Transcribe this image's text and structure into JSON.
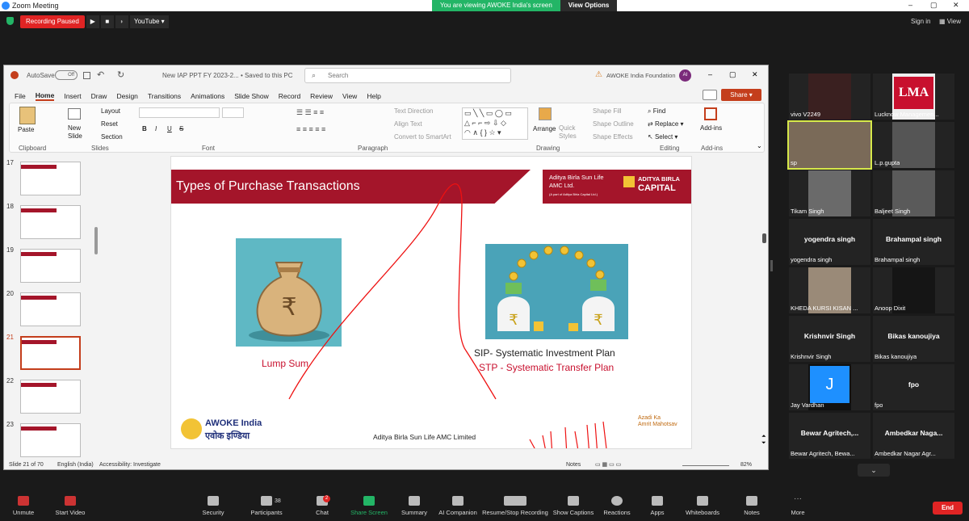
{
  "window": {
    "title": "Zoom Meeting"
  },
  "banner": {
    "text": "You are viewing AWOKE India's screen",
    "view_options": "View Options"
  },
  "topbar": {
    "recording": "Recording Paused",
    "youtube": "YouTube",
    "sign_in": "Sign in",
    "view": "View"
  },
  "ppt": {
    "autosave": "AutoSave",
    "autosave_state": "Off",
    "doc_title": "New IAP PPT FY 2023-2... • Saved to this PC",
    "search_placeholder": "Search",
    "org": "AWOKE India Foundation",
    "avatar": "AI",
    "share": "Share",
    "tabs": [
      "File",
      "Home",
      "Insert",
      "Draw",
      "Design",
      "Transitions",
      "Animations",
      "Slide Show",
      "Record",
      "Review",
      "View",
      "Help"
    ],
    "ribbon": {
      "paste": "Paste",
      "clipboard": "Clipboard",
      "new_slide": "New Slide",
      "layout": "Layout",
      "reset": "Reset",
      "section": "Section",
      "slides": "Slides",
      "font": "Font",
      "paragraph": "Paragraph",
      "text_direction": "Text Direction",
      "align_text": "Align Text",
      "smartart": "Convert to SmartArt",
      "arrange": "Arrange",
      "quick_styles": "Quick Styles",
      "shape_fill": "Shape Fill",
      "shape_outline": "Shape Outline",
      "shape_effects": "Shape Effects",
      "drawing": "Drawing",
      "find": "Find",
      "replace": "Replace",
      "select": "Select",
      "editing": "Editing",
      "addins": "Add-ins",
      "addins_group": "Add-ins"
    },
    "thumbs": [
      "17",
      "18",
      "19",
      "20",
      "21",
      "22",
      "23"
    ],
    "status": {
      "slide": "Slide 21 of 70",
      "lang": "English (India)",
      "accessibility": "Accessibility: Investigate",
      "notes": "Notes",
      "zoom": "82%"
    }
  },
  "slide": {
    "title": "Types of Purchase Transactions",
    "brand_line1": "Aditya Birla Sun Life",
    "brand_line2": "AMC Ltd.",
    "brand_sub": "(A part of Aditya Birla Capital Ltd.)",
    "logo_top": "ADITYA BIRLA",
    "logo_bottom": "CAPITAL",
    "lump_sum": "Lump Sum",
    "sip": "SIP- Systematic Investment Plan",
    "stp": "STP - Systematic Transfer Plan",
    "awoke": "AWOKE India",
    "awoke_hindi": "एवोक इण्डिया",
    "footer": "Aditya Birla Sun Life AMC Limited",
    "azadi1": "Azadi",
    "azadi2": "Ka",
    "azadi3": "Amrit Mahotsav"
  },
  "participants": [
    {
      "name": "vivo V2249",
      "big": ""
    },
    {
      "name": "Lucknow Managemen...",
      "big": ""
    },
    {
      "name": "sp",
      "big": ""
    },
    {
      "name": "L.p.gupta",
      "big": ""
    },
    {
      "name": "Tikam Singh",
      "big": ""
    },
    {
      "name": "Baljeet Singh",
      "big": ""
    },
    {
      "name": "yogendra singh",
      "big": "yogendra singh"
    },
    {
      "name": "Brahampal singh",
      "big": "Brahampal singh"
    },
    {
      "name": "KHEDA KURSI KISAN ...",
      "big": ""
    },
    {
      "name": "Anoop Dixit",
      "big": ""
    },
    {
      "name": "Krishnvir Singh",
      "big": "Krishnvir Singh"
    },
    {
      "name": "Bikas kanoujiya",
      "big": "Bikas kanoujiya"
    },
    {
      "name": "Jay Vardhan",
      "big": ""
    },
    {
      "name": "fpo",
      "big": "fpo"
    },
    {
      "name": "Bewar Agritech, Bewa...",
      "big": "Bewar Agritech,..."
    },
    {
      "name": "Ambedkar Nagar Agr...",
      "big": "Ambedkar Naga..."
    }
  ],
  "avatar_letter": "J",
  "lma": "LMA",
  "toolbar": {
    "unmute": "Unmute",
    "video": "Start Video",
    "security": "Security",
    "participants": "Participants",
    "participants_count": "38",
    "chat": "Chat",
    "chat_badge": "2",
    "share": "Share Screen",
    "summary": "Summary",
    "ai": "AI Companion",
    "record": "Resume/Stop Recording",
    "captions": "Show Captions",
    "reactions": "Reactions",
    "apps": "Apps",
    "whiteboards": "Whiteboards",
    "notes": "Notes",
    "more": "More",
    "end": "End"
  },
  "colors": {
    "accent": "#b5152b",
    "zoom_green": "#23b566",
    "end_red": "#e02424"
  }
}
